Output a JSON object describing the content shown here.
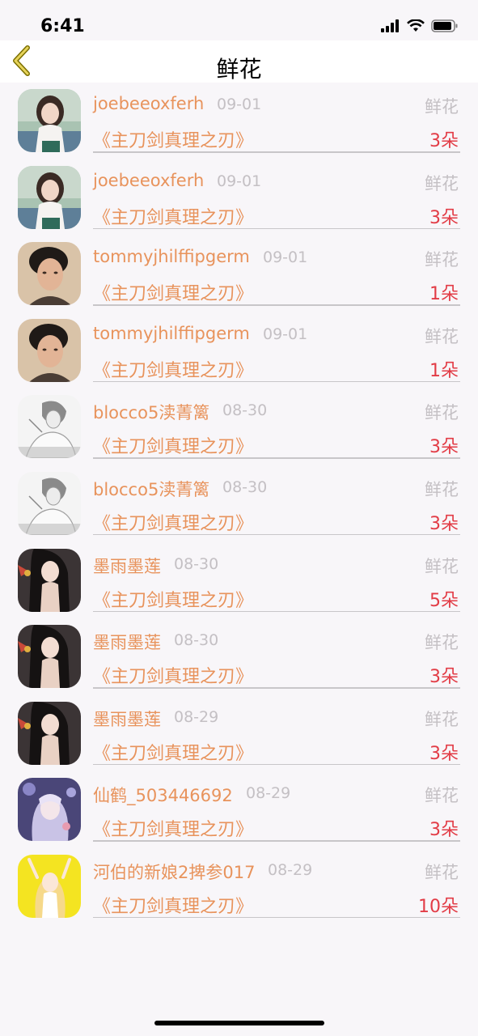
{
  "status_bar": {
    "time": "6:41"
  },
  "nav": {
    "title": "鲜花"
  },
  "colors": {
    "accent": "#e8935c",
    "count": "#e23c46",
    "muted": "#c4c0c4",
    "background": "#f8f6f9"
  },
  "rows": [
    {
      "name": "joebeeoxferh",
      "date": "09-01",
      "gift": "鲜花",
      "work": "《主刀剑真理之刃》",
      "count": "3朵",
      "avatar": "girl-photo"
    },
    {
      "name": "joebeeoxferh",
      "date": "09-01",
      "gift": "鲜花",
      "work": "《主刀剑真理之刃》",
      "count": "3朵",
      "avatar": "girl-photo"
    },
    {
      "name": "tommyjhilffipgerm",
      "date": "09-01",
      "gift": "鲜花",
      "work": "《主刀剑真理之刃》",
      "count": "1朵",
      "avatar": "man-photo"
    },
    {
      "name": "tommyjhilffipgerm",
      "date": "09-01",
      "gift": "鲜花",
      "work": "《主刀剑真理之刃》",
      "count": "1朵",
      "avatar": "man-photo"
    },
    {
      "name": "blocco5渎菁篱",
      "date": "08-30",
      "gift": "鲜花",
      "work": "《主刀剑真理之刃》",
      "count": "3朵",
      "avatar": "sketch"
    },
    {
      "name": "blocco5渎菁篱",
      "date": "08-30",
      "gift": "鲜花",
      "work": "《主刀剑真理之刃》",
      "count": "3朵",
      "avatar": "sketch"
    },
    {
      "name": "墨雨墨莲",
      "date": "08-30",
      "gift": "鲜花",
      "work": "《主刀剑真理之刃》",
      "count": "5朵",
      "avatar": "anime-dark"
    },
    {
      "name": "墨雨墨莲",
      "date": "08-30",
      "gift": "鲜花",
      "work": "《主刀剑真理之刃》",
      "count": "3朵",
      "avatar": "anime-dark"
    },
    {
      "name": "墨雨墨莲",
      "date": "08-29",
      "gift": "鲜花",
      "work": "《主刀剑真理之刃》",
      "count": "3朵",
      "avatar": "anime-dark"
    },
    {
      "name": "仙鹤_503446692",
      "date": "08-29",
      "gift": "鲜花",
      "work": "《主刀剑真理之刃》",
      "count": "3朵",
      "avatar": "anime-purple"
    },
    {
      "name": "河伯的新娘2捭参017",
      "date": "08-29",
      "gift": "鲜花",
      "work": "《主刀剑真理之刃》",
      "count": "10朵",
      "avatar": "anime-yellow"
    }
  ]
}
